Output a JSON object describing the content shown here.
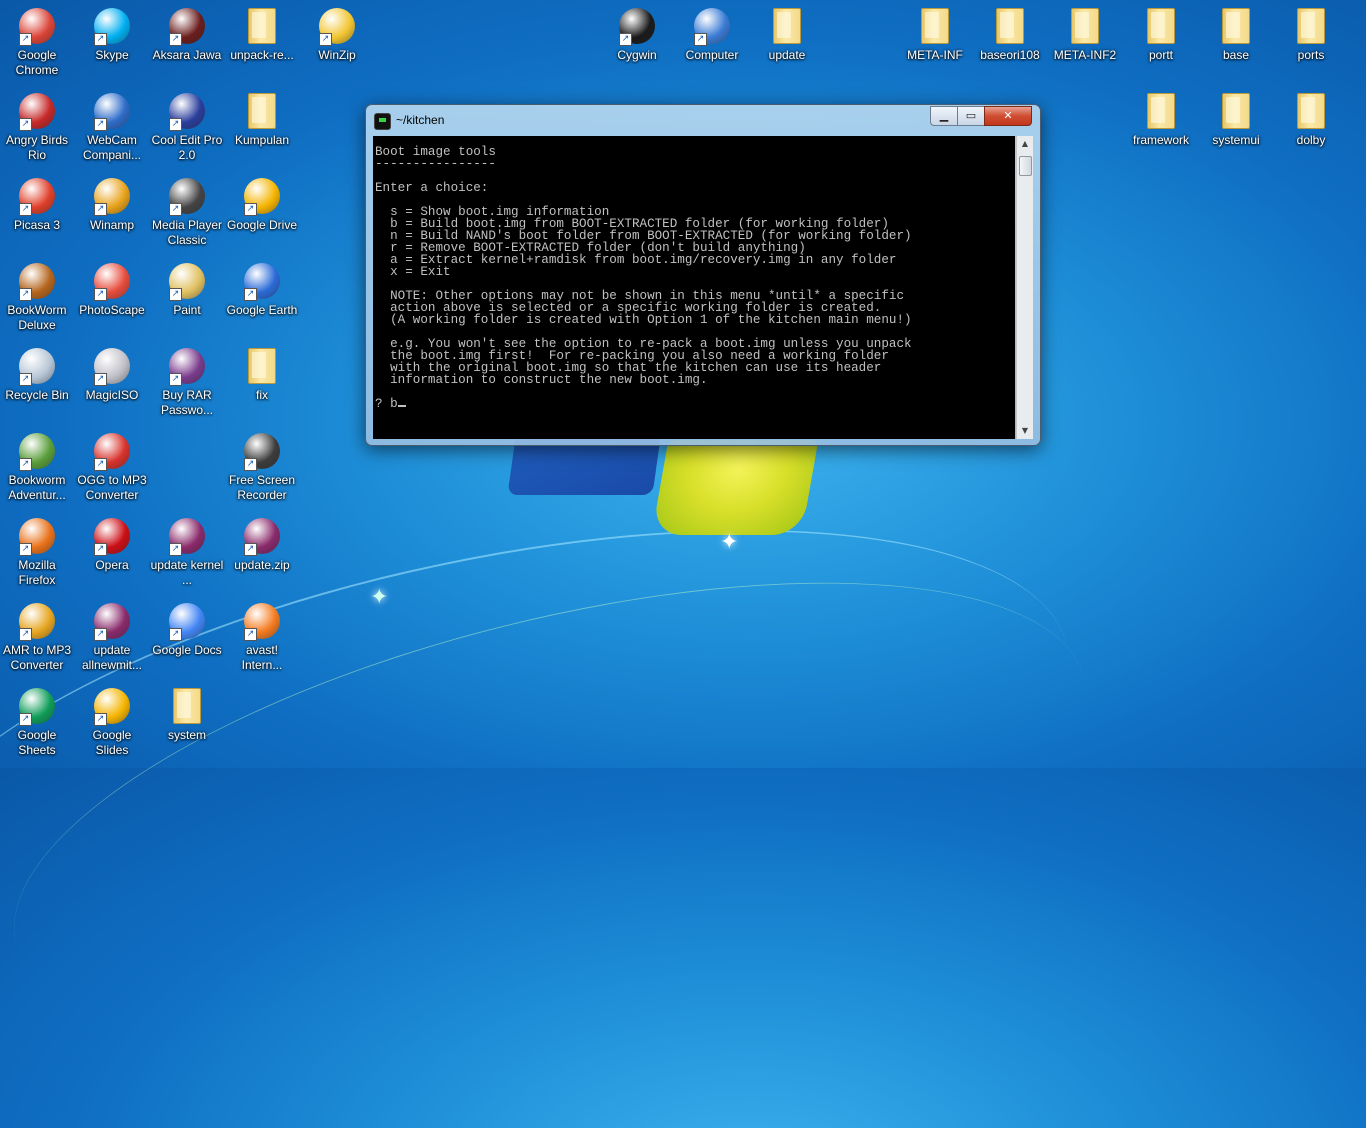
{
  "desktop": {
    "icons": [
      {
        "label": "Google Chrome",
        "icon": "chrome-icon",
        "kind": "app",
        "color": "#db4437"
      },
      {
        "label": "Skype",
        "icon": "skype-icon",
        "kind": "app",
        "color": "#00aff0"
      },
      {
        "label": "Aksara Jawa",
        "icon": "aksara-jawa-icon",
        "kind": "app",
        "color": "#6b1d1d"
      },
      {
        "label": "unpack-re...",
        "icon": "folder-icon",
        "kind": "folder",
        "color": "#f3d98a"
      },
      {
        "label": "WinZip",
        "icon": "winzip-icon",
        "kind": "app",
        "color": "#f2c530"
      },
      {
        "label": "Cygwin",
        "icon": "cygwin-icon",
        "kind": "app",
        "color": "#1a1a1a"
      },
      {
        "label": "Computer",
        "icon": "computer-icon",
        "kind": "app",
        "color": "#3a7bd5"
      },
      {
        "label": "update",
        "icon": "folder-icon",
        "kind": "folder",
        "color": "#f3d98a"
      },
      {
        "label": "META-INF",
        "icon": "folder-icon",
        "kind": "folder",
        "color": "#f3d98a"
      },
      {
        "label": "baseori108",
        "icon": "folder-icon",
        "kind": "folder",
        "color": "#f3d98a"
      },
      {
        "label": "META-INF2",
        "icon": "folder-icon",
        "kind": "folder",
        "color": "#f3d98a"
      },
      {
        "label": "portt",
        "icon": "folder-icon",
        "kind": "folder",
        "color": "#f3d98a"
      },
      {
        "label": "base",
        "icon": "folder-icon",
        "kind": "folder",
        "color": "#f3d98a"
      },
      {
        "label": "ports",
        "icon": "folder-icon",
        "kind": "folder",
        "color": "#f3d98a"
      },
      {
        "label": "Angry Birds Rio",
        "icon": "angry-birds-icon",
        "kind": "app",
        "color": "#c62828"
      },
      {
        "label": "WebCam Compani...",
        "icon": "webcam-icon",
        "kind": "app",
        "color": "#2e6cc9"
      },
      {
        "label": "Cool Edit Pro 2.0",
        "icon": "cool-edit-icon",
        "kind": "app",
        "color": "#2a3e9c"
      },
      {
        "label": "Kumpulan",
        "icon": "folder-icon",
        "kind": "folder",
        "color": "#f3d98a"
      },
      {
        "label": "framework",
        "icon": "folder-icon",
        "kind": "folder",
        "color": "#f3d98a"
      },
      {
        "label": "systemui",
        "icon": "folder-icon",
        "kind": "folder",
        "color": "#f3d98a"
      },
      {
        "label": "dolby",
        "icon": "folder-icon",
        "kind": "folder",
        "color": "#f3d98a"
      },
      {
        "label": "Picasa 3",
        "icon": "picasa-icon",
        "kind": "app",
        "color": "#e0402a"
      },
      {
        "label": "Winamp",
        "icon": "winamp-icon",
        "kind": "app",
        "color": "#e8a21a"
      },
      {
        "label": "Media Player Classic",
        "icon": "media-player-icon",
        "kind": "app",
        "color": "#444444"
      },
      {
        "label": "Google Drive",
        "icon": "google-drive-icon",
        "kind": "app",
        "color": "#f4b400"
      },
      {
        "label": "BookWorm Deluxe",
        "icon": "bookworm-icon",
        "kind": "app",
        "color": "#b5651d"
      },
      {
        "label": "PhotoScape",
        "icon": "photoscape-icon",
        "kind": "app",
        "color": "#e74c3c"
      },
      {
        "label": "Paint",
        "icon": "paint-icon",
        "kind": "app",
        "color": "#e0c060"
      },
      {
        "label": "Google Earth",
        "icon": "google-earth-icon",
        "kind": "app",
        "color": "#2b6bd8"
      },
      {
        "label": "Recycle Bin",
        "icon": "recycle-bin-icon",
        "kind": "app",
        "color": "#b7c6d6"
      },
      {
        "label": "MagicISO",
        "icon": "magiciso-icon",
        "kind": "app",
        "color": "#c0c0c8"
      },
      {
        "label": "Buy RAR Passwo...",
        "icon": "rar-icon",
        "kind": "app",
        "color": "#7a3b8c"
      },
      {
        "label": "fix",
        "icon": "folder-icon",
        "kind": "folder",
        "color": "#f3d98a"
      },
      {
        "label": "Bookworm Adventur...",
        "icon": "bookworm-adventures-icon",
        "kind": "app",
        "color": "#5a9e3a"
      },
      {
        "label": "OGG to MP3 Converter",
        "icon": "ogg-mp3-icon",
        "kind": "app",
        "color": "#d8322c"
      },
      {
        "label": "Free Screen Recorder",
        "icon": "screen-recorder-icon",
        "kind": "app",
        "color": "#3c3c3c"
      },
      {
        "label": "Mozilla Firefox",
        "icon": "firefox-icon",
        "kind": "app",
        "color": "#e8711a"
      },
      {
        "label": "Opera",
        "icon": "opera-icon",
        "kind": "app",
        "color": "#cc0f16"
      },
      {
        "label": "update kernel ...",
        "icon": "winrar-icon",
        "kind": "app",
        "color": "#8a2a6b"
      },
      {
        "label": "update.zip",
        "icon": "winrar-icon",
        "kind": "app",
        "color": "#8a2a6b"
      },
      {
        "label": "AMR to MP3 Converter",
        "icon": "amr-mp3-icon",
        "kind": "app",
        "color": "#e6a51f"
      },
      {
        "label": "update allnewmit...",
        "icon": "winrar-icon",
        "kind": "app",
        "color": "#8a2a6b"
      },
      {
        "label": "Google Docs",
        "icon": "google-docs-icon",
        "kind": "app",
        "color": "#4285f4"
      },
      {
        "label": "avast! Intern...",
        "icon": "avast-icon",
        "kind": "app",
        "color": "#f47b20"
      },
      {
        "label": "Google Sheets",
        "icon": "google-sheets-icon",
        "kind": "app",
        "color": "#0f9d58"
      },
      {
        "label": "Google Slides",
        "icon": "google-slides-icon",
        "kind": "app",
        "color": "#f4b400"
      },
      {
        "label": "system",
        "icon": "folder-icon",
        "kind": "folder",
        "color": "#f3d98a"
      }
    ]
  },
  "window": {
    "title": "~/kitchen",
    "minimize_glyph": "▁",
    "maximize_glyph": "▭",
    "close_glyph": "✕",
    "console_lines": [
      "Boot image tools",
      "----------------",
      "",
      "Enter a choice:",
      "",
      "  s = Show boot.img information",
      "  b = Build boot.img from BOOT-EXTRACTED folder (for working folder)",
      "  n = Build NAND's boot folder from BOOT-EXTRACTED (for working folder)",
      "  r = Remove BOOT-EXTRACTED folder (don't build anything)",
      "  a = Extract kernel+ramdisk from boot.img/recovery.img in any folder",
      "  x = Exit",
      "",
      "  NOTE: Other options may not be shown in this menu *until* a specific",
      "  action above is selected or a specific working folder is created.",
      "  (A working folder is created with Option 1 of the kitchen main menu!)",
      "",
      "  e.g. You won't see the option to re-pack a boot.img unless you unpack",
      "  the boot.img first!  For re-packing you also need a working folder",
      "  with the original boot.img so that the kitchen can use its header",
      "  information to construct the new boot.img.",
      ""
    ],
    "prompt": "? b"
  }
}
